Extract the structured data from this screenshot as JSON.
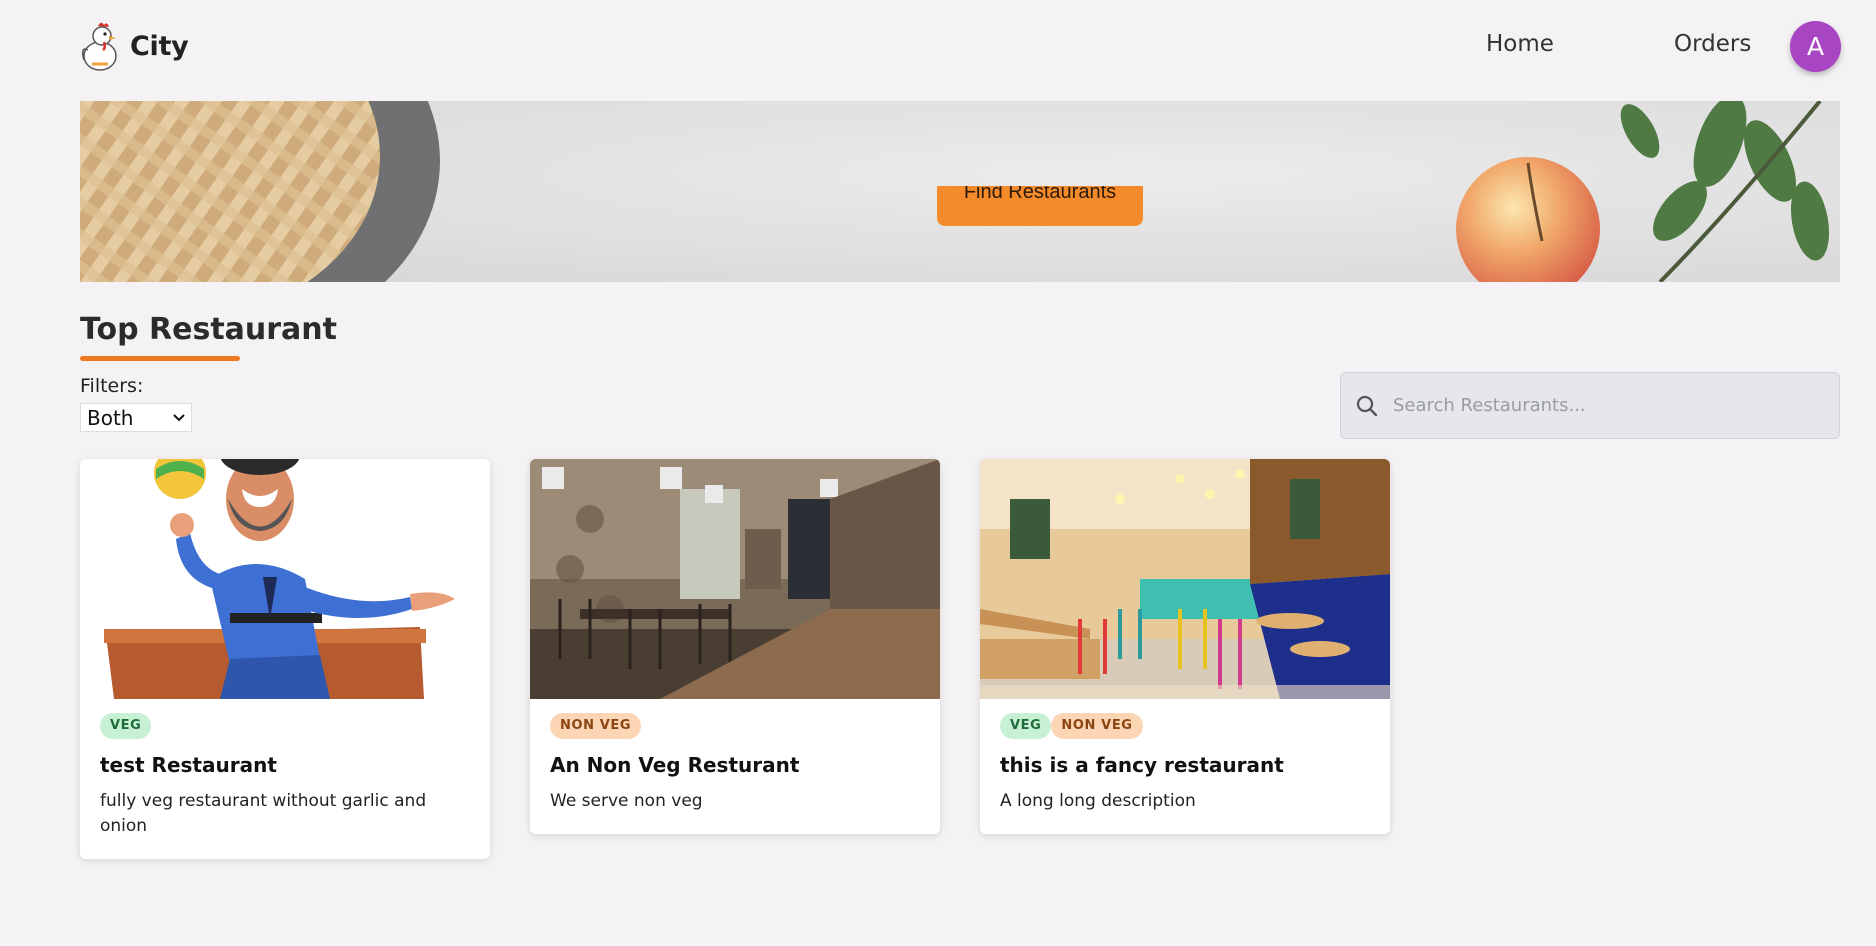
{
  "app": {
    "name": "City"
  },
  "nav": {
    "home": "Home",
    "orders": "Orders",
    "avatar_initial": "A"
  },
  "hero": {
    "cta_label": "Find Restaurants"
  },
  "section": {
    "title": "Top Restaurant"
  },
  "filters": {
    "label": "Filters:",
    "selected": "Both"
  },
  "search": {
    "placeholder": "Search Restaurants..."
  },
  "restaurants": [
    {
      "tags": [
        "VEG"
      ],
      "name": "test Restaurant",
      "description": "fully veg restaurant without garlic and onion"
    },
    {
      "tags": [
        "NON VEG"
      ],
      "name": "An Non Veg Resturant",
      "description": "We serve non veg"
    },
    {
      "tags": [
        "VEG",
        "NON VEG"
      ],
      "name": "this is a fancy restaurant",
      "description": "A long long description"
    }
  ],
  "colors": {
    "accent": "#f58a2b",
    "avatar": "#a845c3",
    "veg_tag": "#c8f0d4",
    "nonveg_tag": "#fcd6b4"
  }
}
